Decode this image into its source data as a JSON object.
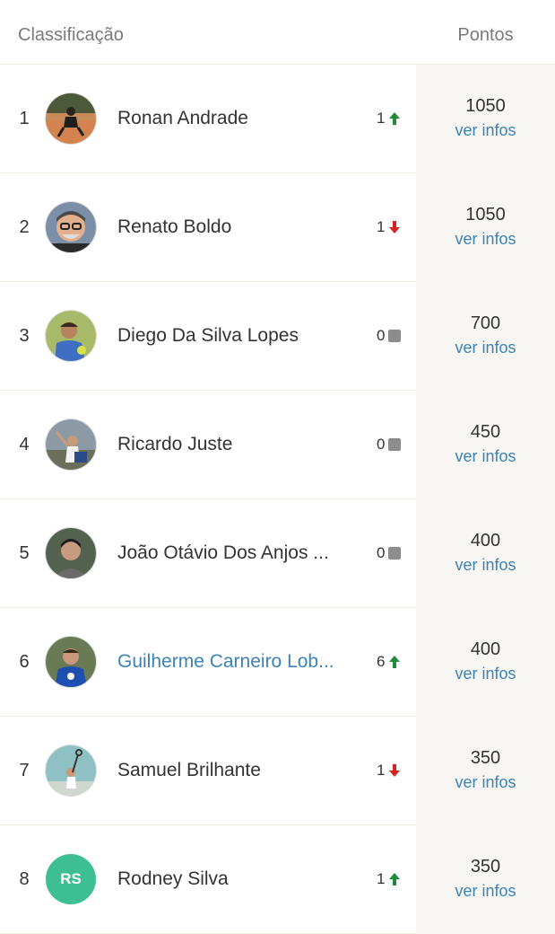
{
  "header": {
    "ranking_label": "Classificação",
    "points_label": "Pontos"
  },
  "colors": {
    "up": "#1e8a3a",
    "down": "#d82121",
    "neutral": "#8c8c8c",
    "link": "#3c82b4",
    "initials_bg": "#3dbf93"
  },
  "players": [
    {
      "rank": "1",
      "name": "Ronan Andrade",
      "change": "1",
      "trend": "up",
      "points": "1050",
      "more": "ver infos",
      "avatar": "photo"
    },
    {
      "rank": "2",
      "name": "Renato Boldo",
      "change": "1",
      "trend": "down",
      "points": "1050",
      "more": "ver infos",
      "avatar": "photo"
    },
    {
      "rank": "3",
      "name": "Diego Da Silva Lopes",
      "change": "0",
      "trend": "same",
      "points": "700",
      "more": "ver infos",
      "avatar": "photo"
    },
    {
      "rank": "4",
      "name": "Ricardo Juste",
      "change": "0",
      "trend": "same",
      "points": "450",
      "more": "ver infos",
      "avatar": "photo"
    },
    {
      "rank": "5",
      "name": "João Otávio Dos Anjos ...",
      "change": "0",
      "trend": "same",
      "points": "400",
      "more": "ver infos",
      "avatar": "photo"
    },
    {
      "rank": "6",
      "name": "Guilherme Carneiro Lob...",
      "change": "6",
      "trend": "up",
      "points": "400",
      "more": "ver infos",
      "avatar": "photo",
      "highlight": true
    },
    {
      "rank": "7",
      "name": "Samuel Brilhante",
      "change": "1",
      "trend": "down",
      "points": "350",
      "more": "ver infos",
      "avatar": "photo"
    },
    {
      "rank": "8",
      "name": "Rodney Silva",
      "change": "1",
      "trend": "up",
      "points": "350",
      "more": "ver infos",
      "avatar": "initials",
      "initials": "RS"
    }
  ]
}
